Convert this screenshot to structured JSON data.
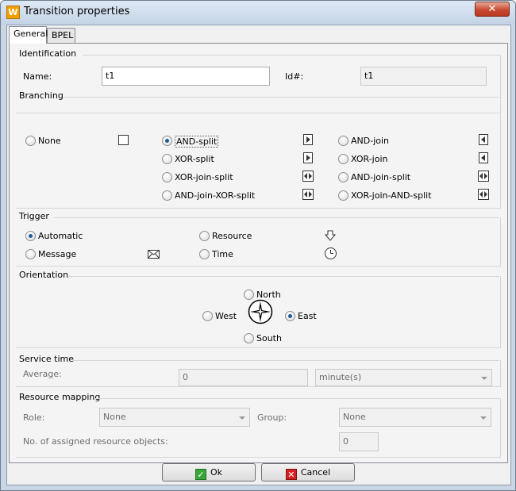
{
  "window": {
    "title": "Transition properties",
    "app_icon": "W",
    "close": "✕",
    "accent": "#1c5a9c"
  },
  "tabs": [
    {
      "label": "General",
      "active": true
    },
    {
      "label": "BPEL",
      "active": false
    }
  ],
  "identification": {
    "title": "Identification",
    "name_label": "Name:",
    "name_value": "t1",
    "id_label": "Id#:",
    "id_value": "t1"
  },
  "branching": {
    "title": "Branching",
    "options": [
      {
        "label": "None",
        "selected": false,
        "icon": "none-square-icon"
      },
      {
        "label": "AND-split",
        "selected": true,
        "icon": "and-split-icon"
      },
      {
        "label": "XOR-split",
        "selected": false,
        "icon": "xor-split-icon"
      },
      {
        "label": "XOR-join-split",
        "selected": false,
        "icon": "xor-join-split-icon"
      },
      {
        "label": "AND-join-XOR-split",
        "selected": false,
        "icon": "and-join-xor-split-icon"
      },
      {
        "label": "AND-join",
        "selected": false,
        "icon": "and-join-icon"
      },
      {
        "label": "XOR-join",
        "selected": false,
        "icon": "xor-join-icon"
      },
      {
        "label": "AND-join-split",
        "selected": false,
        "icon": "and-join-split-icon"
      },
      {
        "label": "XOR-join-AND-split",
        "selected": false,
        "icon": "xor-join-and-split-icon"
      }
    ]
  },
  "trigger": {
    "title": "Trigger",
    "automatic": "Automatic",
    "message": "Message",
    "resource": "Resource",
    "time": "Time",
    "selected": "Automatic"
  },
  "orientation": {
    "title": "Orientation",
    "north": "North",
    "west": "West",
    "east": "East",
    "south": "South",
    "selected": "East"
  },
  "service_time": {
    "title": "Service time",
    "average_label": "Average:",
    "average_value": "0",
    "unit": "minute(s)"
  },
  "resource_mapping": {
    "title": "Resource mapping",
    "role_label": "Role:",
    "role_value": "None",
    "group_label": "Group:",
    "group_value": "None",
    "assigned_label": "No. of assigned resource objects:",
    "assigned_value": "0"
  },
  "buttons": {
    "ok": "Ok",
    "cancel": "Cancel"
  }
}
